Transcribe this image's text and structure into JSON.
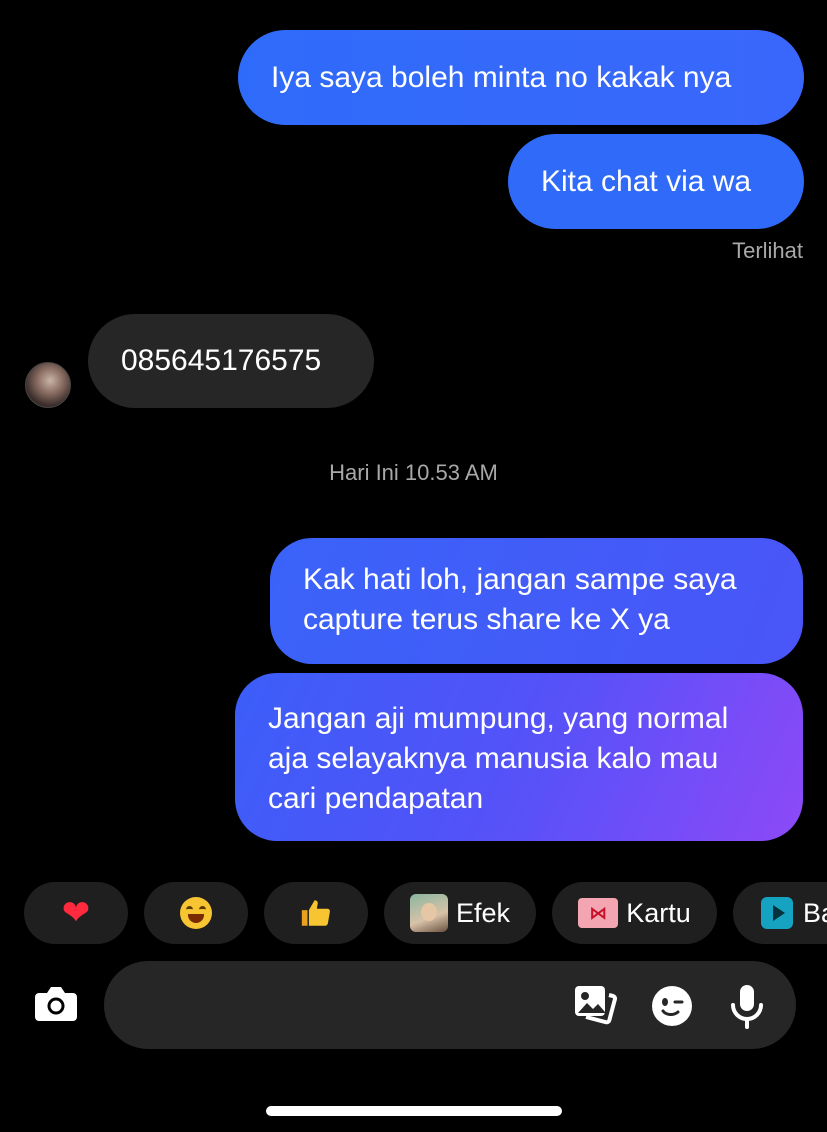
{
  "messages": {
    "sent_1": "Iya saya boleh minta no kakak nya",
    "sent_2": "Kita chat via wa",
    "seen_label": "Terlihat",
    "received_1": "085645176575",
    "timestamp": "Hari Ini 10.53 AM",
    "sent_3_line1": "Kak hati loh, jangan sampe saya",
    "sent_3_line2": "capture terus share ke X ya",
    "sent_4_line1": "Jangan aji mumpung, yang normal",
    "sent_4_line2": "aja selayaknya manusia kalo mau",
    "sent_4_line3": "cari pendapatan"
  },
  "quick_reactions": {
    "heart": "❤",
    "laugh": "😂",
    "thumbs_up": "👍",
    "efek_label": "Efek",
    "kartu_label": "Kartu",
    "ba_label": "Ba"
  },
  "composer": {
    "placeholder": ""
  },
  "colors": {
    "background": "#000000",
    "sent_bubble": "#2f6af9",
    "sent_gradient_end": "#8d49f7",
    "received_bubble": "#262626",
    "muted_text": "#a8a8a8"
  }
}
